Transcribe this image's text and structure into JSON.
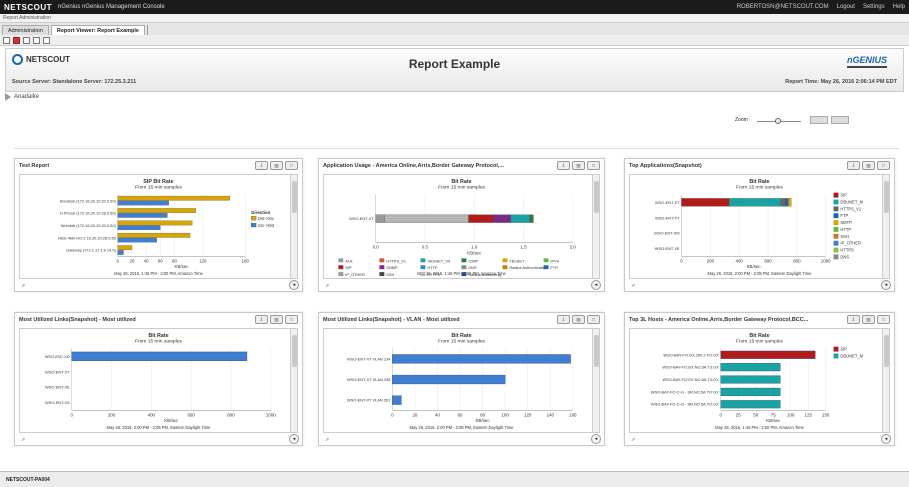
{
  "titlebar": {
    "logo": "NETSCOUT",
    "app": "nGenius   nGenius Management Console",
    "user": "ROBERTOSN@NETSCOUT.COM",
    "logout": "Logout",
    "settings": "Settings",
    "help": "Help"
  },
  "subbar": {
    "label": "Report Administration"
  },
  "tabs": [
    {
      "label": "Administration"
    },
    {
      "label": "Report Viewer: Report Example"
    }
  ],
  "header": {
    "brand": "NETSCOUT",
    "title": "Report Example",
    "genius": "nGENIUS",
    "source": "Source Server: Standalone Server: 172.25.3.211",
    "time": "Report Time: May 26, 2016 2:06:14 PM EDT"
  },
  "nav": {
    "label": "Anadalke"
  },
  "zoom": {
    "label": "Zoom"
  },
  "panels": [
    {
      "title": "Test Report"
    },
    {
      "title": "Application Usage - America Online,Arris,Border Gateway Protocol,..."
    },
    {
      "title": "Top Applications(Snapshot)"
    },
    {
      "title": "Most Utilized Links(Snapshot) - Most utilized"
    },
    {
      "title": "Most Utilized Links(Snapshot) - VLAN - Most utilized"
    },
    {
      "title": "Top 3L Hosts - America Online,Arris,Border Gateway Protocol,BCC..."
    }
  ],
  "status": {
    "text": "NETSCOUT-PA004"
  },
  "chart_data": [
    {
      "type": "bar",
      "orientation": "horizontal",
      "title": "SIP Bit Rate",
      "subtitle": "From 15 min samples",
      "categories": [
        "Brooklyn (172.16.20.10:20.0.50)",
        "H Phone (172.16.20.10:28.0.50)",
        "Wombat (172.16.20.10:20.0.50)",
        "HBG 4kb/ HO:2.16.20.10:28.0.50",
        "Gateway (172.1.17.1.9.14.0)"
      ],
      "series": [
        {
          "name": "Dst->Src",
          "color": "#d9a500",
          "values": [
            158,
            110,
            105,
            102,
            20
          ]
        },
        {
          "name": "Src->Dst",
          "color": "#3f7ed1",
          "values": [
            72,
            70,
            60,
            55,
            8
          ]
        }
      ],
      "xlim": [
        0,
        180
      ],
      "xticks": [
        0,
        20,
        40,
        60,
        80,
        120,
        180
      ],
      "xlabel": "KB/sec",
      "legend_title": "Direction",
      "footer": "May 26, 2016, 1:45 PM - 2:00 PM, Amazon Time"
    },
    {
      "type": "bar",
      "orientation": "horizontal",
      "stacked": true,
      "title": "Bit Rate",
      "subtitle": "From 15 min samples",
      "categories": [
        "WSO-ENT-XT"
      ],
      "values": [
        {
          "name": "AOL",
          "color": "#999999",
          "value": 5
        },
        {
          "name": "HTTPS",
          "color": "#b5b5b5",
          "value": 48
        },
        {
          "name": "DNS",
          "color": "#b31b1b",
          "value": 14
        },
        {
          "name": "BGP",
          "color": "#7a2a8a",
          "value": 10
        },
        {
          "name": "SSH",
          "color": "#1aa3a3",
          "value": 11
        },
        {
          "name": "ICMP",
          "color": "#2e7d32",
          "value": 2
        }
      ],
      "xlim": [
        0,
        2
      ],
      "xticks": [
        "0.0",
        "0.5",
        "1.0",
        "1.5",
        "2.0"
      ],
      "xlabel": "KB/sec",
      "legend": [
        "AOL",
        "HTTPS_V1",
        "SKUNET_V4",
        "ICMP",
        "TELNET",
        "IPV4",
        "SIP",
        "SNMP",
        "HTTP",
        "DNS",
        "Radius Authentication",
        "FTP",
        "IP_OTHER",
        "SSH",
        "HTTPS",
        "Radius Accounting"
      ],
      "footer": "May 26, 2016, 1:45 PM - 2:00 PM, Amazon Time"
    },
    {
      "type": "bar",
      "orientation": "horizontal",
      "stacked": true,
      "title": "Bit Rate",
      "subtitle": "From 15 min samples",
      "categories": [
        "WSO-ENT-XT",
        "WSO-ENT-XT",
        "WSO-ENT-XM",
        "WSO-ENT-XE"
      ],
      "values": [
        {
          "name": "SIP",
          "color": "#b31b1b",
          "value": 330
        },
        {
          "name": "DBUNET_M",
          "color": "#1aa3a3",
          "value": 360
        },
        {
          "name": "SSH",
          "color": "#666666",
          "value": 30
        },
        {
          "name": "HTTP",
          "color": "#1b66b1",
          "value": 20
        },
        {
          "name": "FTP",
          "color": "#d9a500",
          "value": 20
        }
      ],
      "xlim": [
        0,
        1000
      ],
      "xticks": [
        0,
        200,
        400,
        600,
        800,
        1000
      ],
      "xlabel": "KB/sec",
      "legend": [
        "SIP",
        "DBUNET_M",
        "HTTPS_V1",
        "FTP",
        "SMTP",
        "HTTP",
        "SSH",
        "IP_OTHER",
        "HTTPS",
        "DNS"
      ],
      "footer": "May 26, 2016, 2:00 PM - 2:05 PM, Eastern Daylight Time"
    },
    {
      "type": "bar",
      "orientation": "horizontal",
      "title": "Bit Rate",
      "subtitle": "From 15 min samples",
      "categories": [
        "WSO-ENT-XD",
        "WSO-ENT-XT",
        "WSO-ENT-XE",
        "WSO-ENT-XS"
      ],
      "values": [
        880,
        0,
        0,
        0
      ],
      "color": "#3f7ed1",
      "xlim": [
        0,
        1000
      ],
      "xticks": [
        0,
        200,
        400,
        600,
        800,
        1000
      ],
      "xlabel": "KB/sec",
      "footer": "May 26, 2016, 2:00 PM - 2:05 PM, Eastern Daylight Time"
    },
    {
      "type": "bar",
      "orientation": "horizontal",
      "title": "Bit Rate",
      "subtitle": "From 15 min samples",
      "categories": [
        "WSO-ENT-XT VLAN 134",
        "WSO-ENT-XT VLAN 248",
        "WSO-ENT-XT VLAN 267"
      ],
      "values": [
        158,
        100,
        8
      ],
      "color": "#3f7ed1",
      "xlim": [
        0,
        160
      ],
      "xticks": [
        0,
        20,
        40,
        60,
        80,
        100,
        120,
        140,
        160
      ],
      "xlabel": "KB/sec",
      "footer": "May 26, 2016, 2:00 PM - 2:05 PM, Eastern Daylight Time"
    },
    {
      "type": "bar",
      "orientation": "horizontal",
      "title": "Bit Rate",
      "subtitle": "From 15 min samples",
      "categories": [
        "WSO-BAY-FO:GX.260.2.FO:GX",
        "WSO-BAY-FO:GX.NO.5A.T3:GX",
        "WSO-BAY-FO:GX.NO.5A.T3:GX",
        "WSO-BAY-FO-C-G - 3M.NO.5A.TO:GX",
        "WSO-BAY-FO-C-G - 3M.NO.5A.TO:GX"
      ],
      "values": [
        135,
        85,
        85,
        85,
        85
      ],
      "colors": [
        "#b31b1b",
        "#1aa3a3",
        "#1aa3a3",
        "#1aa3a3",
        "#1aa3a3"
      ],
      "xlim": [
        0,
        150
      ],
      "xticks": [
        0,
        25,
        50,
        75,
        100,
        125,
        150
      ],
      "xlabel": "KB/sec",
      "legend": [
        "SIP",
        "DBUNET_M"
      ],
      "footer": "May 26, 2016, 1:45 PM - 2:00 PM, Amazon Time"
    }
  ]
}
